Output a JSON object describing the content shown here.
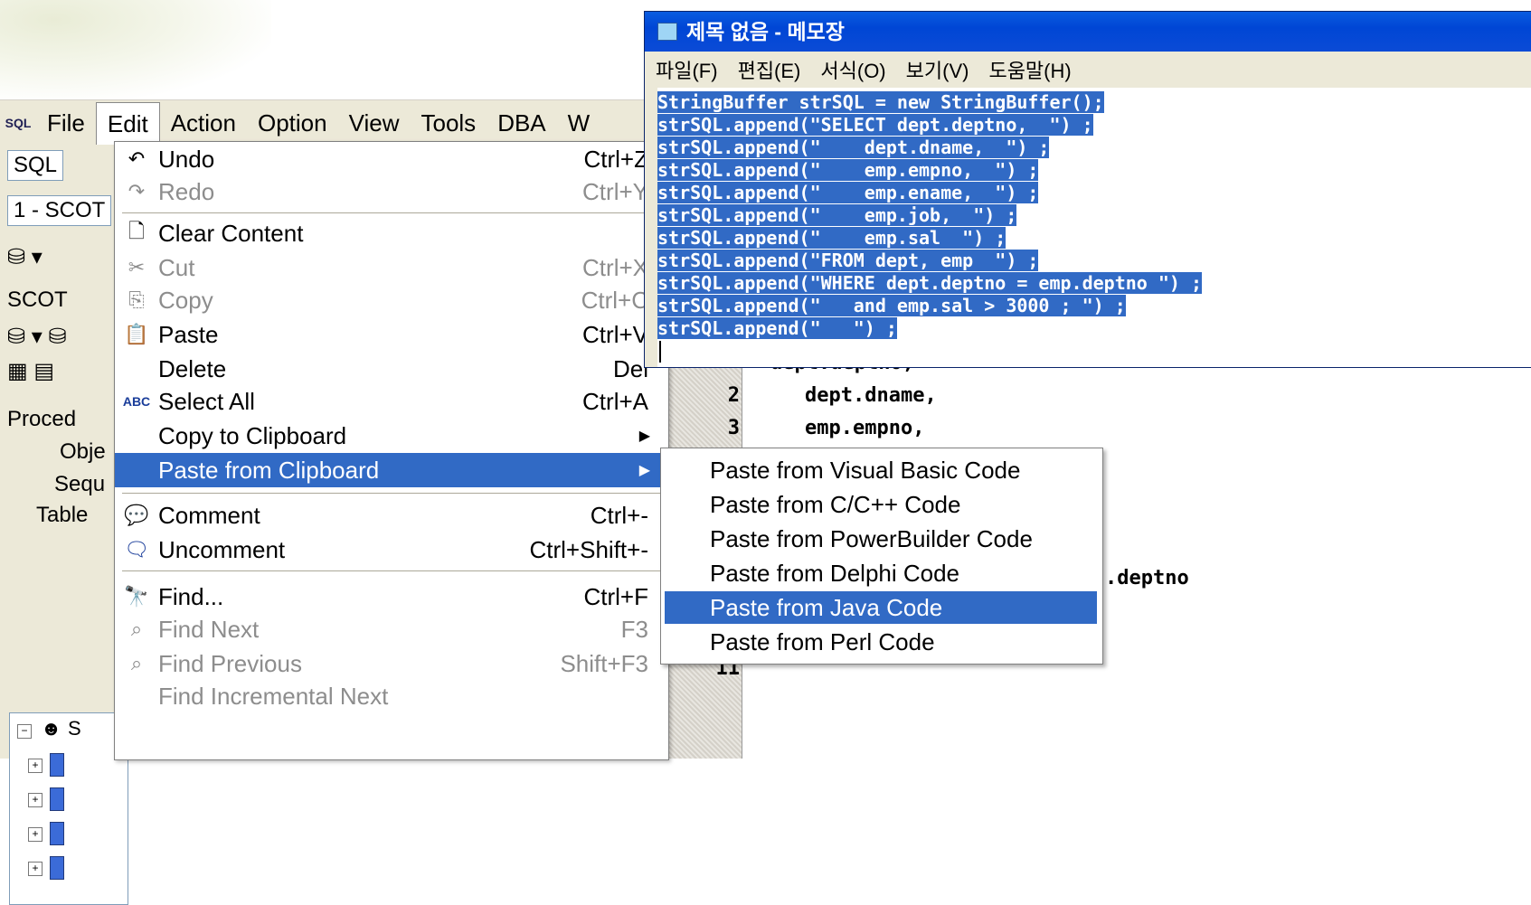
{
  "app_menubar": {
    "app_icon": "sql-icon",
    "items": [
      "File",
      "Edit",
      "Action",
      "Option",
      "View",
      "Tools",
      "DBA",
      "W"
    ]
  },
  "left_strip": {
    "sql_tab": "SQL",
    "connection": "1 - SCOT",
    "schema_label": "SCOT",
    "proc_label": "Proced",
    "obj_label": "Obje",
    "seq_label": "Sequ",
    "table_label": "Table",
    "tree_root": "S"
  },
  "edit_menu": {
    "items": [
      {
        "icon": "undo-icon",
        "label": "Undo",
        "shortcut": "Ctrl+Z",
        "disabled": false
      },
      {
        "icon": "redo-icon",
        "label": "Redo",
        "shortcut": "Ctrl+Y",
        "disabled": true
      },
      {
        "icon": "page-icon",
        "label": "Clear Content",
        "shortcut": "",
        "disabled": false
      },
      {
        "icon": "scissors-icon",
        "label": "Cut",
        "shortcut": "Ctrl+X",
        "disabled": true
      },
      {
        "icon": "copy-icon",
        "label": "Copy",
        "shortcut": "Ctrl+C",
        "disabled": true
      },
      {
        "icon": "paste-icon",
        "label": "Paste",
        "shortcut": "Ctrl+V",
        "disabled": false
      },
      {
        "icon": "",
        "label": "Delete",
        "shortcut": "Del",
        "disabled": false
      },
      {
        "icon": "select-all-icon",
        "label": "Select All",
        "shortcut": "Ctrl+A",
        "disabled": false
      },
      {
        "icon": "",
        "label": "Copy to Clipboard",
        "shortcut": "",
        "disabled": false
      },
      {
        "icon": "",
        "label": "Paste from Clipboard",
        "shortcut": "",
        "disabled": false
      },
      {
        "icon": "comment-icon",
        "label": "Comment",
        "shortcut": "Ctrl+-",
        "disabled": false
      },
      {
        "icon": "uncomment-icon",
        "label": "Uncomment",
        "shortcut": "Ctrl+Shift+-",
        "disabled": false
      },
      {
        "icon": "binoculars-icon",
        "label": "Find...",
        "shortcut": "Ctrl+F",
        "disabled": false
      },
      {
        "icon": "find-next-icon",
        "label": "Find Next",
        "shortcut": "F3",
        "disabled": true
      },
      {
        "icon": "find-previous-icon",
        "label": "Find Previous",
        "shortcut": "Shift+F3",
        "disabled": true
      },
      {
        "icon": "",
        "label": "Find Incremental Next",
        "shortcut": "",
        "disabled": true
      }
    ]
  },
  "submenu": {
    "items": [
      "Paste from Visual Basic Code",
      "Paste from C/C++ Code",
      "Paste from PowerBuilder Code",
      "Paste from Delphi Code",
      "Paste from Java Code",
      "Paste from Perl Code"
    ],
    "highlighted": "Paste from Java Code"
  },
  "editor": {
    "line_numbers": [
      "2",
      "3",
      "11"
    ],
    "lines": [
      "dept.dname,",
      "emp.empno,",
      ".deptno"
    ],
    "partial_top": "dept.deptno,"
  },
  "notepad": {
    "title": "제목 없음 - 메모장",
    "menu": [
      "파일(F)",
      "편집(E)",
      "서식(O)",
      "보기(V)",
      "도움말(H)"
    ],
    "lines": [
      "StringBuffer strSQL = new StringBuffer();",
      "strSQL.append(\"SELECT dept.deptno,  \") ;",
      "strSQL.append(\"    dept.dname,  \") ;",
      "strSQL.append(\"    emp.empno,  \") ;",
      "strSQL.append(\"    emp.ename,  \") ;",
      "strSQL.append(\"    emp.job,  \") ;",
      "strSQL.append(\"    emp.sal  \") ;",
      "strSQL.append(\"FROM dept, emp  \") ;",
      "strSQL.append(\"WHERE dept.deptno = emp.deptno \") ;",
      "strSQL.append(\"   and emp.sal > 3000 ; \") ;",
      "strSQL.append(\"   \") ;"
    ]
  }
}
